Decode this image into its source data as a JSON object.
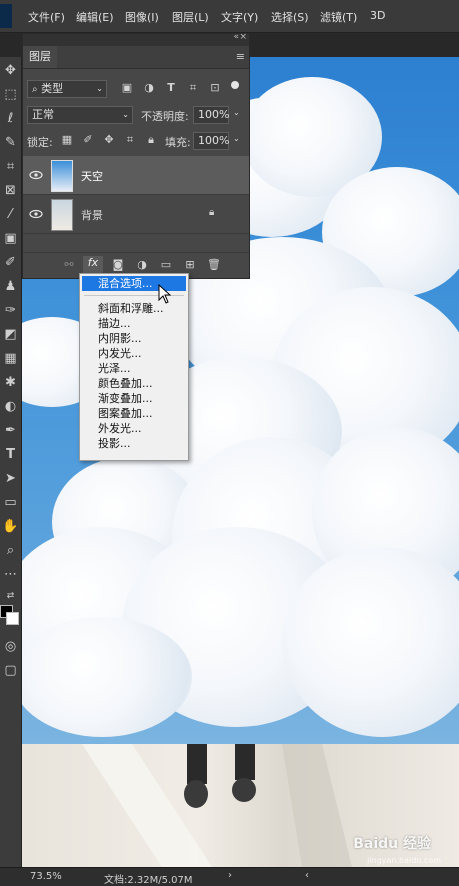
{
  "menubar": {
    "items": [
      "文件(F)",
      "编辑(E)",
      "图像(I)",
      "图层(L)",
      "文字(Y)",
      "选择(S)",
      "滤镜(T)",
      "3D"
    ]
  },
  "layers_panel": {
    "tab_label": "图层",
    "filter_kind": "类型",
    "blend_mode": "正常",
    "opacity_label": "不透明度:",
    "opacity_value": "100%",
    "lock_label": "锁定:",
    "fill_label": "填充:",
    "fill_value": "100%",
    "layers": [
      {
        "name": "天空",
        "selected": true
      },
      {
        "name": "背景",
        "selected": false,
        "locked": true
      }
    ],
    "footer_fx_label": "fx"
  },
  "context_menu": {
    "items": [
      "混合选项...",
      "斜面和浮雕...",
      "描边...",
      "内阴影...",
      "内发光...",
      "光泽...",
      "颜色叠加...",
      "渐变叠加...",
      "图案叠加...",
      "外发光...",
      "投影..."
    ],
    "selected_index": 0
  },
  "statusbar": {
    "zoom": "73.5%",
    "doc_info": "文档:2.32M/5.07M"
  },
  "watermark": {
    "text": "Baidu 经验",
    "url": "jingyan.baidu.com"
  },
  "colors": {
    "menu_bg": "#3a3a3a",
    "panel_bg": "#474747",
    "selected_layer": "#5a5a5a",
    "menu_highlight": "#1e78e4",
    "sky_blue": "#3b8fd8"
  }
}
